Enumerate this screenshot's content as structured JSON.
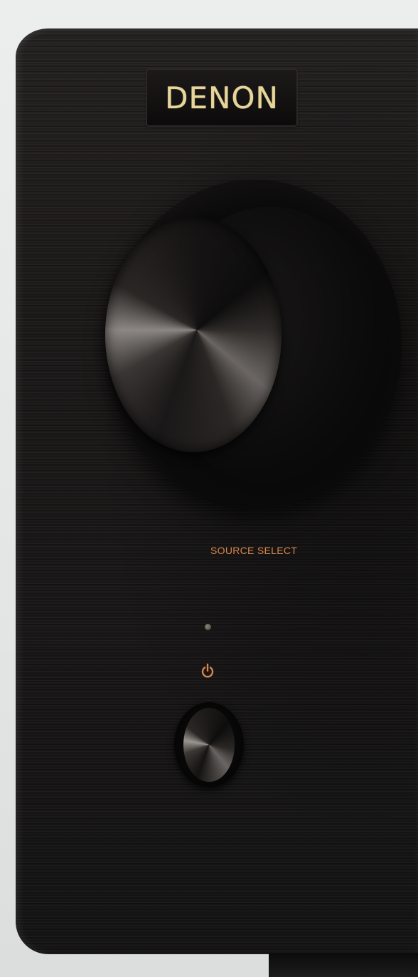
{
  "brand": {
    "logo_text": "DENON"
  },
  "controls": {
    "source_select_label": "SOURCE SELECT"
  },
  "colors": {
    "panel": "#1b1918",
    "label_orange": "#d8864a",
    "logo_gold": "#e8d59a"
  },
  "icons": {
    "power": "power-icon",
    "led": "standby-led"
  }
}
